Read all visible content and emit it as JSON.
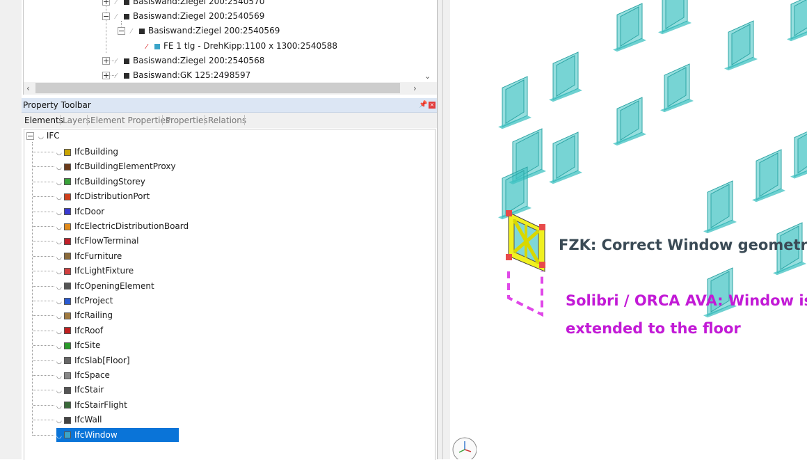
{
  "top_tree": {
    "rows": [
      {
        "label": "Basiswand:Ziegel 200:2540570"
      },
      {
        "label": "Basiswand:Ziegel 200:2540569"
      },
      {
        "label": "Basiswand:Ziegel 200:2540569"
      },
      {
        "label": "FE 1 tlg - DrehKipp:1100 x 1300:2540588"
      },
      {
        "label": "Basiswand:Ziegel 200:2540568"
      },
      {
        "label": "Basiswand:GK 125:2498597"
      }
    ]
  },
  "property_toolbar": {
    "title": "Property Toolbar",
    "tabs": [
      "Elements",
      "Layers",
      "Element Properties",
      "Properties",
      "Relations"
    ],
    "root": "IFC",
    "items": [
      {
        "label": "IfcBuilding",
        "color": "#c9a400"
      },
      {
        "label": "IfcBuildingElementProxy",
        "color": "#6b3b1a"
      },
      {
        "label": "IfcBuildingStorey",
        "color": "#3aa23a"
      },
      {
        "label": "IfcDistributionPort",
        "color": "#d0401c"
      },
      {
        "label": "IfcDoor",
        "color": "#3a3ad0"
      },
      {
        "label": "IfcElectricDistributionBoard",
        "color": "#e08a1c"
      },
      {
        "label": "IfcFlowTerminal",
        "color": "#c0202a"
      },
      {
        "label": "IfcFurniture",
        "color": "#8b6a3a"
      },
      {
        "label": "IfcLightFixture",
        "color": "#d04040"
      },
      {
        "label": "IfcOpeningElement",
        "color": "#555555"
      },
      {
        "label": "IfcProject",
        "color": "#2a5ad0"
      },
      {
        "label": "IfcRailing",
        "color": "#a07a40"
      },
      {
        "label": "IfcRoof",
        "color": "#c02020"
      },
      {
        "label": "IfcSite",
        "color": "#2a9a2a"
      },
      {
        "label": "IfcSlab[Floor]",
        "color": "#666666"
      },
      {
        "label": "IfcSpace",
        "color": "#888888"
      },
      {
        "label": "IfcStair",
        "color": "#555555"
      },
      {
        "label": "IfcStairFlight",
        "color": "#3a6a3a"
      },
      {
        "label": "IfcWall",
        "color": "#444444"
      },
      {
        "label": "IfcWindow",
        "color": "#3aa4c8"
      }
    ],
    "selected": "IfcWindow"
  },
  "viewport": {
    "correct_label": "FZK: Correct Window geometry",
    "solibri_line1": "Solibri / ORCA AVA: Window is",
    "solibri_line2": "extended to the floor",
    "window_color": "#3fc2c2",
    "highlight_color": "#f0f020",
    "magenta": "#e048e8"
  }
}
